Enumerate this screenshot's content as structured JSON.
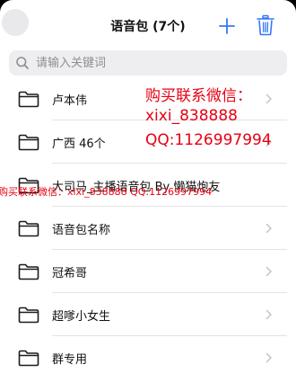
{
  "header": {
    "title": "语音包 (7个)"
  },
  "search": {
    "placeholder": "请输入关键词"
  },
  "list": {
    "items": [
      {
        "label": "卢本伟"
      },
      {
        "label": "广西 46个"
      },
      {
        "label": "大司马_主播语音包 By 懒猫炮友"
      },
      {
        "label": "语音包名称"
      },
      {
        "label": "冠希哥"
      },
      {
        "label": "超嗲小女生"
      },
      {
        "label": "群专用"
      }
    ]
  },
  "watermark": {
    "line1": "购买联系微信：",
    "line2": "xixi_838888",
    "line3": "QQ:1126997994",
    "line4": "购买联系微信：xixi_838888  QQ:1126997994"
  },
  "colors": {
    "accent": "#3478f6",
    "watermark": "#e60012",
    "separator": "#e3e3e6"
  },
  "icons": {
    "close": "close-icon",
    "add": "plus-icon",
    "trash": "trash-icon",
    "search": "search-icon",
    "folder": "folder-icon",
    "chevron": "chevron-right-icon"
  }
}
